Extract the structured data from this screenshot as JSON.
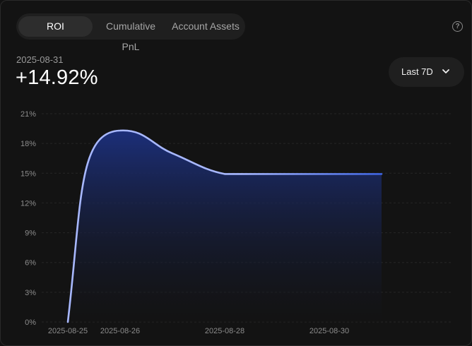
{
  "tabs": [
    {
      "label": "ROI",
      "active": true
    },
    {
      "label": "Cumulative PnL",
      "active": false
    },
    {
      "label": "Account Assets",
      "active": false
    }
  ],
  "help_icon": "question-circle-icon",
  "summary": {
    "date": "2025-08-31",
    "value": "+14.92%"
  },
  "range_select": {
    "label": "Last 7D",
    "icon": "chevron-down-icon"
  },
  "colors": {
    "line_start": "#a8b8ff",
    "line_end": "#3d63e0",
    "fill_top": "#1c2f7a",
    "background": "#131313"
  },
  "chart_data": {
    "type": "area",
    "title": "",
    "xlabel": "",
    "ylabel": "",
    "y_ticks": [
      "0%",
      "3%",
      "6%",
      "9%",
      "12%",
      "15%",
      "18%",
      "21%"
    ],
    "x_ticks": [
      "2025-08-25",
      "2025-08-26",
      "2025-08-28",
      "2025-08-30"
    ],
    "ylim": [
      0,
      21
    ],
    "grid": true,
    "series": [
      {
        "x": [
          "2025-08-25",
          "2025-08-26",
          "2025-08-27",
          "2025-08-28",
          "2025-08-29",
          "2025-08-30",
          "2025-08-31"
        ],
        "values": [
          0.0,
          19.3,
          17.0,
          14.92,
          14.92,
          14.92,
          14.92
        ]
      }
    ]
  }
}
